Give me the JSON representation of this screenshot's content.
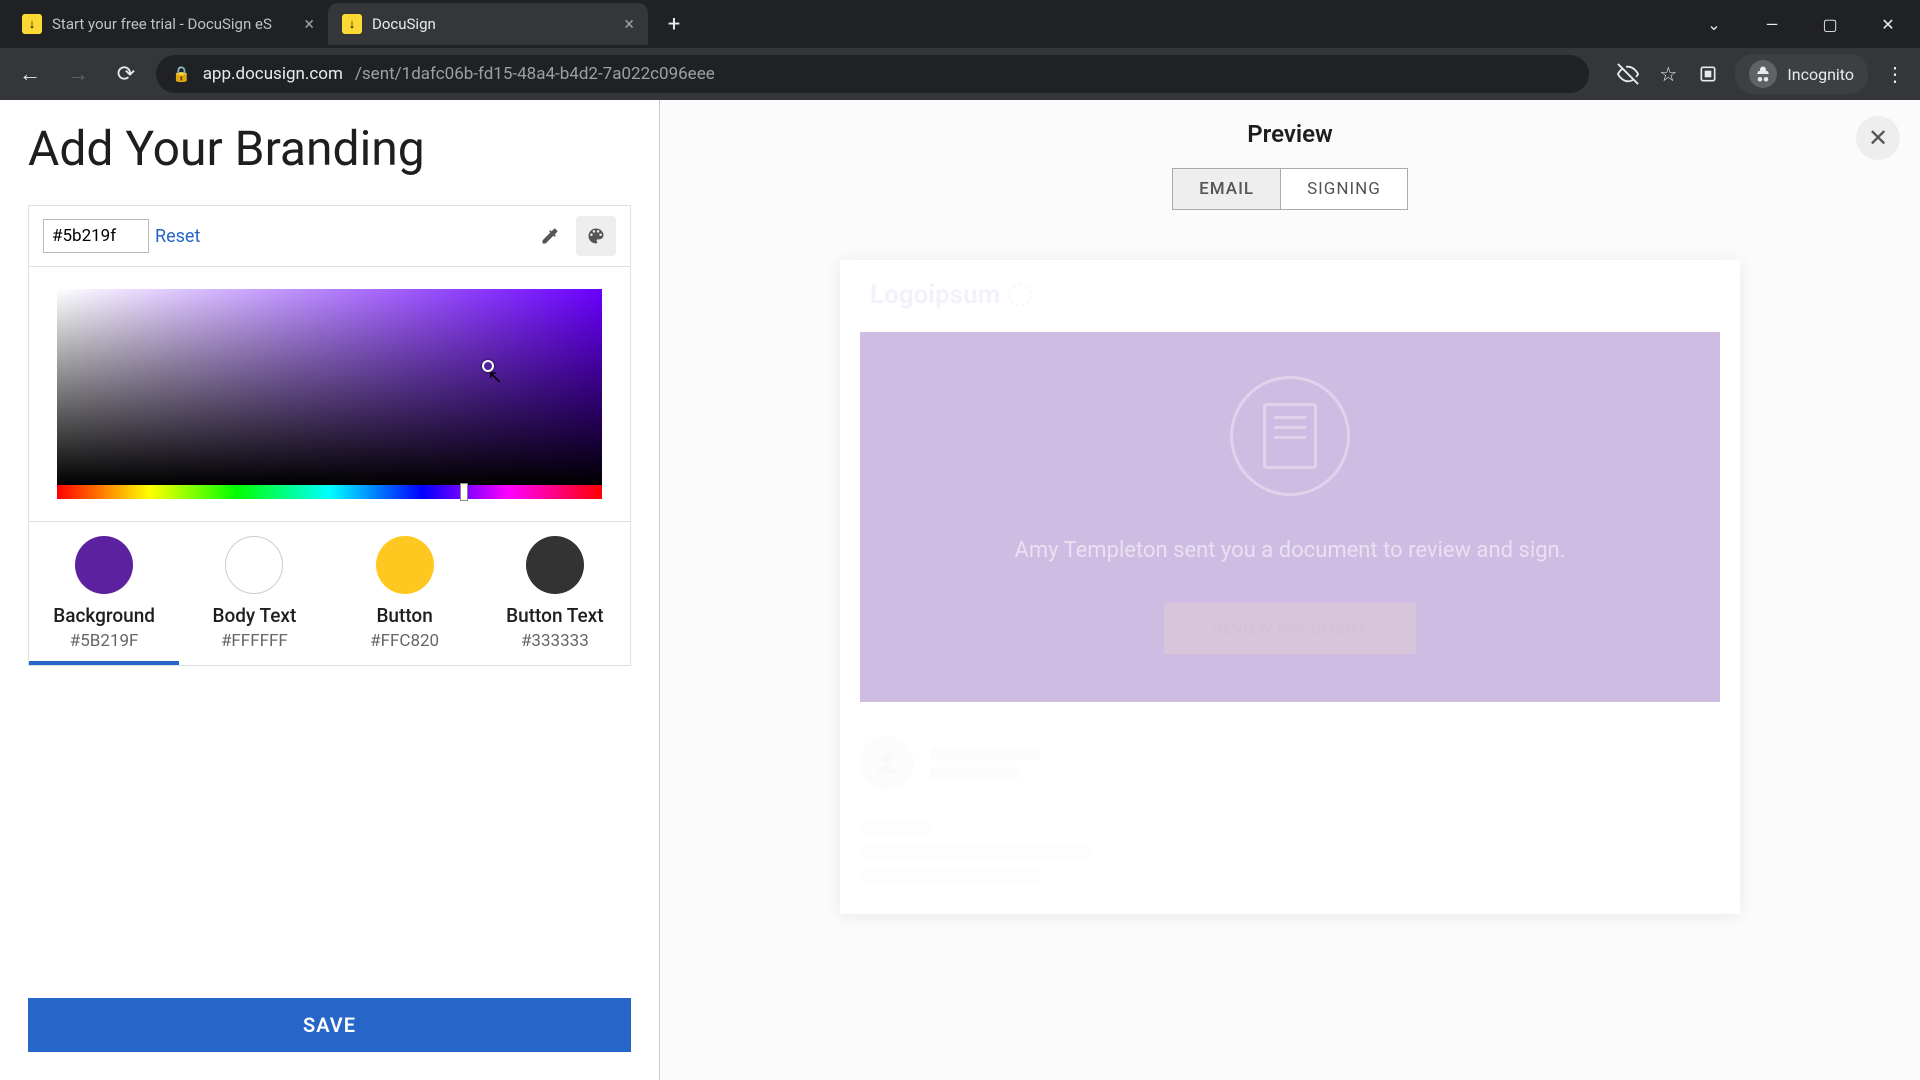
{
  "browser": {
    "tabs": [
      {
        "title": "Start your free trial - DocuSign eS",
        "active": false
      },
      {
        "title": "DocuSign",
        "active": true
      }
    ],
    "url_domain": "app.docusign.com",
    "url_path": "/sent/1dafc06b-fd15-48a4-b4d2-7a022c096eee",
    "incognito_label": "Incognito"
  },
  "page": {
    "title": "Add Your Branding",
    "hex_value": "#5b219f",
    "reset_label": "Reset",
    "save_label": "SAVE"
  },
  "swatches": [
    {
      "label": "Background",
      "hex": "#5B219F",
      "color": "#5b219f",
      "selected": true,
      "bordered": false
    },
    {
      "label": "Body Text",
      "hex": "#FFFFFF",
      "color": "#ffffff",
      "selected": false,
      "bordered": true
    },
    {
      "label": "Button",
      "hex": "#FFC820",
      "color": "#ffc820",
      "selected": false,
      "bordered": false
    },
    {
      "label": "Button Text",
      "hex": "#333333",
      "color": "#333333",
      "selected": false,
      "bordered": false
    }
  ],
  "preview": {
    "title": "Preview",
    "tabs": {
      "email": "EMAIL",
      "signing": "SIGNING"
    },
    "logo_text": "Logoipsum",
    "message": "Amy Templeton sent you a document to review and sign.",
    "button_label": "REVIEW DOCUMENT",
    "background_color": "#5b219f"
  }
}
